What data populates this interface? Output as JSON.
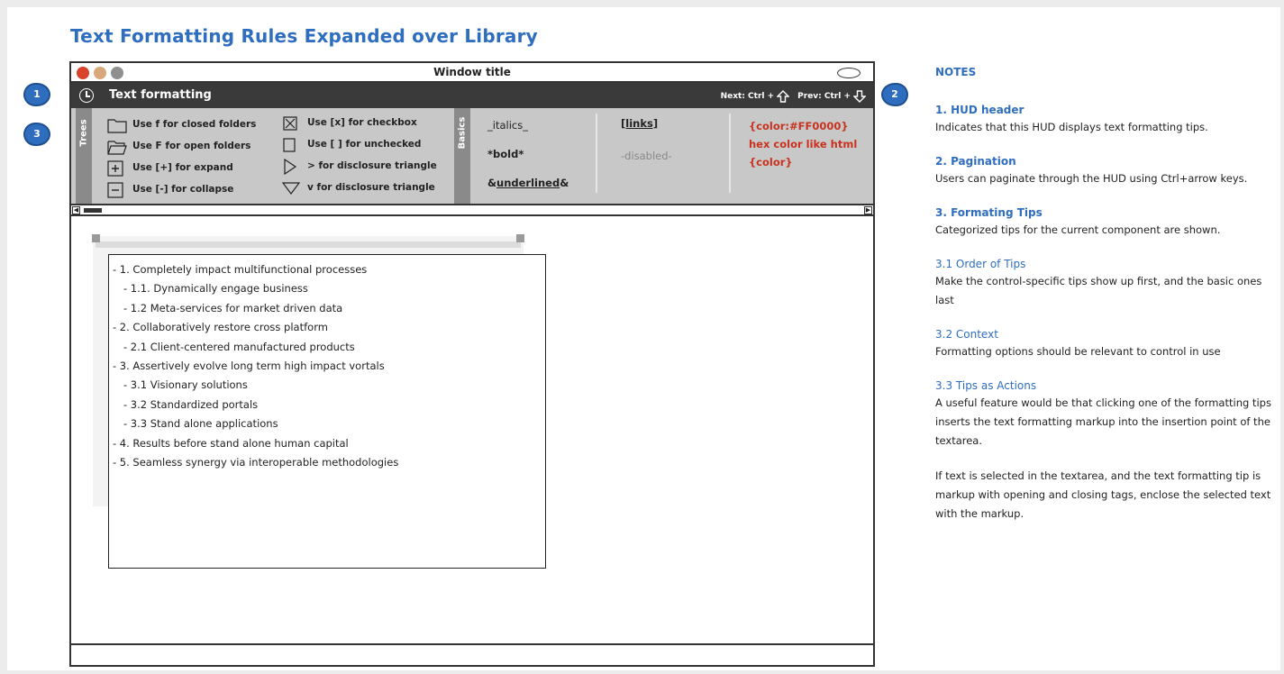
{
  "page_title": "Text Formatting Rules Expanded over Library",
  "window": {
    "title": "Window title"
  },
  "hud": {
    "title": "Text formatting",
    "next_label": "Next: Ctrl +",
    "prev_label": "Prev: Ctrl +",
    "icon": "clock-icon"
  },
  "callouts": [
    "1",
    "2",
    "3"
  ],
  "tips": {
    "trees_label": "Trees",
    "basics_label": "Basics",
    "trees": [
      {
        "icon": "closed-folder-icon",
        "text": "Use f for closed folders"
      },
      {
        "icon": "open-folder-icon",
        "text": "Use F for open folders"
      },
      {
        "icon": "expand-icon",
        "text": "Use [+] for expand"
      },
      {
        "icon": "collapse-icon",
        "text": "Use [-] for collapse"
      },
      {
        "icon": "checked-checkbox-icon",
        "text": "Use [x] for checkbox"
      },
      {
        "icon": "unchecked-checkbox-icon",
        "text": "Use [ ] for unchecked"
      },
      {
        "icon": "disclosure-right-icon",
        "text": "> for disclosure triangle"
      },
      {
        "icon": "disclosure-down-icon",
        "text": "v for disclosure triangle"
      }
    ],
    "basics": {
      "italics": "_italics_",
      "bold": "*bold*",
      "underlined_prefix": "&",
      "underlined": "underlined",
      "underlined_suffix": "&",
      "links": "[links]",
      "disabled": "-disabled-",
      "color1": "{color:#FF0000}",
      "color2": "hex color like html",
      "color3": "{color}",
      "color_accent": "#c8321e"
    }
  },
  "list_items": [
    "- 1. Completely impact multifunctional processes",
    "- 1.1. Dynamically engage business",
    "- 1.2 Meta-services for market driven data",
    "- 2. Collaboratively restore cross platform",
    "- 2.1 Client-centered manufactured products",
    "- 3.  Assertively evolve long term high impact vortals",
    "- 3.1 Visionary solutions",
    "- 3.2 Standardized portals",
    "- 3.3 Stand alone applications",
    "- 4. Results before stand alone human capital",
    "- 5. Seamless synergy via interoperable methodologies"
  ],
  "notes": {
    "heading": "NOTES",
    "items": [
      {
        "title": "1. HUD header",
        "text": "Indicates that this HUD displays text formatting tips."
      },
      {
        "title": "2. Pagination",
        "text": "Users can paginate through the HUD using Ctrl+arrow keys."
      },
      {
        "title": "3. Formating Tips",
        "text": "Categorized tips for the current component are shown."
      },
      {
        "title": "3.1 Order of Tips",
        "text": "Make the control-specific tips show up first, and the basic ones last"
      },
      {
        "title": "3.2 Context",
        "text": "Formatting options should be relevant to control in use"
      },
      {
        "title": "3.3 Tips as Actions",
        "text": "A useful feature would be that clicking one of the formatting tips inserts the text formatting markup into the insertion point of the textarea."
      },
      {
        "title": "",
        "text": "If text is selected in the textarea, and the text formatting tip is markup with opening and closing tags, enclose the selected text with the markup."
      }
    ]
  },
  "colors": {
    "accent_blue": "#2f6ebf",
    "hud_dark": "#3a3a3a",
    "panel_gray": "#c8c8c8"
  }
}
